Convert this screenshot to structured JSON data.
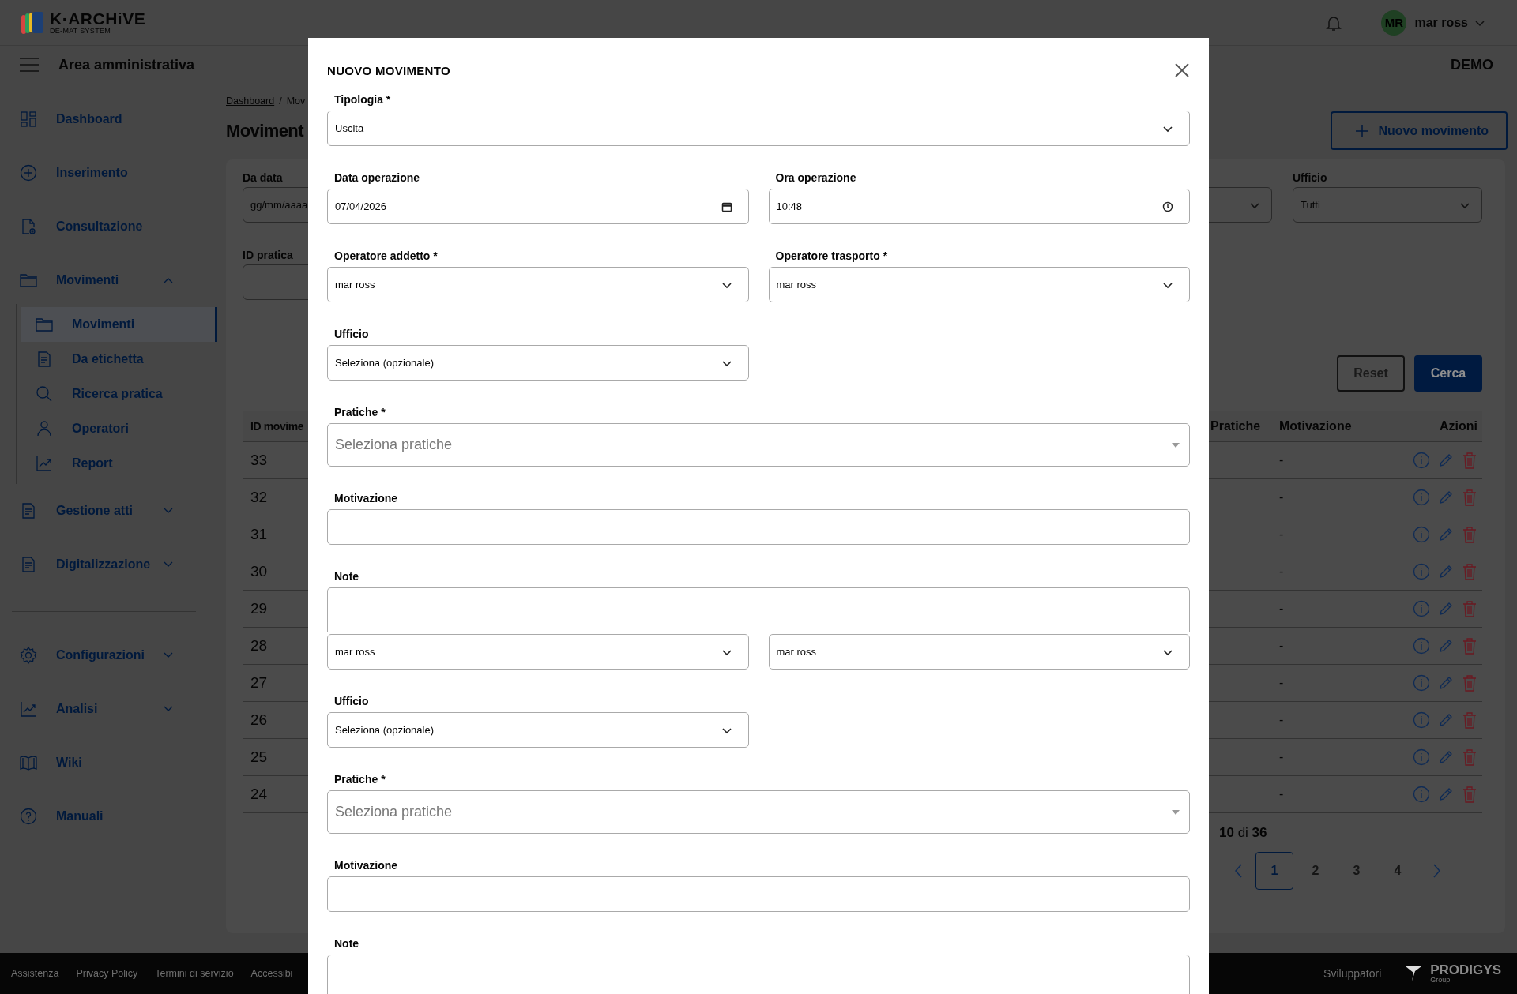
{
  "header": {
    "logo_title": "K·ARCHiVE",
    "logo_subtitle": "DE-MAT SYSTEM",
    "user": {
      "initials": "MR",
      "name": "mar ross"
    }
  },
  "subbar": {
    "title": "Area amministrativa",
    "environment": "DEMO"
  },
  "sidebar": {
    "groups": [
      [
        {
          "label": "Dashboard"
        },
        {
          "label": "Inserimento"
        },
        {
          "label": "Consultazione"
        },
        {
          "label": "Movimenti",
          "expanded": true,
          "children": [
            {
              "label": "Movimenti",
              "selected": true
            },
            {
              "label": "Da etichetta",
              "selected": false
            },
            {
              "label": "Ricerca pratica",
              "selected": false
            },
            {
              "label": "Operatori",
              "selected": false
            },
            {
              "label": "Report",
              "selected": false
            }
          ]
        },
        {
          "label": "Gestione atti",
          "expanded": false
        },
        {
          "label": "Digitalizzazione",
          "expanded": false
        }
      ],
      [
        {
          "label": "Configurazioni",
          "expanded": false
        },
        {
          "label": "Analisi",
          "expanded": false
        },
        {
          "label": "Wiki"
        },
        {
          "label": "Manuali"
        }
      ]
    ]
  },
  "main": {
    "breadcrumb": {
      "items": [
        "Dashboard",
        "Mov"
      ],
      "separator": "/"
    },
    "title": "Moviment",
    "new_button": "Nuovo movimento",
    "filters": {
      "date_label": "Da data",
      "date_placeholder": "gg/mm/aaaa",
      "id_label": "ID pratica",
      "office_label": "Ufficio",
      "office_value": "Tutti"
    },
    "buttons": {
      "reset": "Reset",
      "search": "Cerca"
    },
    "table": {
      "columns": [
        "ID movime",
        "Pratiche",
        "Motivazione",
        "Azioni"
      ],
      "rows": [
        {
          "id": "33",
          "motivazione": "-"
        },
        {
          "id": "32",
          "motivazione": "-"
        },
        {
          "id": "31",
          "motivazione": "-"
        },
        {
          "id": "30",
          "motivazione": "-"
        },
        {
          "id": "29",
          "motivazione": "-"
        },
        {
          "id": "28",
          "motivazione": "-"
        },
        {
          "id": "27",
          "motivazione": "-"
        },
        {
          "id": "26",
          "motivazione": "-"
        },
        {
          "id": "25",
          "motivazione": "-"
        },
        {
          "id": "24",
          "motivazione": "-"
        }
      ]
    },
    "pagination": {
      "summary": "**10** di **36**",
      "pages": [
        {
          "label": "1",
          "selected": true
        },
        {
          "label": "2",
          "selected": false
        },
        {
          "label": "3",
          "selected": false
        },
        {
          "label": "4",
          "selected": false
        }
      ]
    }
  },
  "footer": {
    "links": [
      "Assistenza",
      "Privacy Policy",
      "Termini di servizio",
      "Accessibi"
    ],
    "developers": "Sviluppatori",
    "brand": "PRODIGYS",
    "brand_sub": "Group"
  },
  "modal": {
    "title": "NUOVO MOVIMENTO",
    "rows": [
      [
        {
          "kind": "select",
          "label": "Tipologia *",
          "value": "Uscita",
          "wide": true
        }
      ],
      [
        {
          "kind": "date",
          "label": "Data operazione",
          "value": "07/04/2026"
        },
        {
          "kind": "time",
          "label": "Ora operazione",
          "value": "10:48"
        }
      ],
      [
        {
          "kind": "select",
          "label": "Operatore addetto *",
          "value": "mar ross"
        },
        {
          "kind": "select",
          "label": "Operatore trasporto *",
          "value": "mar ross"
        }
      ],
      [
        {
          "kind": "select",
          "label": "Ufficio",
          "value": "Seleziona (opzionale)"
        }
      ],
      [
        {
          "kind": "multiselect",
          "label": "Pratiche *",
          "placeholder": "Seleziona pratiche",
          "wide": true
        }
      ],
      [
        {
          "kind": "text",
          "label": "Motivazione",
          "wide": true
        }
      ],
      [
        {
          "kind": "textarea",
          "label": "Note",
          "wide": true,
          "clipped": true
        }
      ],
      [
        {
          "kind": "select",
          "value": "mar ross"
        },
        {
          "kind": "select",
          "value": "mar ross"
        }
      ],
      [
        {
          "kind": "select",
          "label": "Ufficio",
          "value": "Seleziona (opzionale)"
        }
      ],
      [
        {
          "kind": "multiselect",
          "label": "Pratiche *",
          "placeholder": "Seleziona pratiche",
          "wide": true
        }
      ],
      [
        {
          "kind": "text",
          "label": "Motivazione",
          "wide": true
        }
      ],
      [
        {
          "kind": "textarea",
          "label": "Note",
          "wide": true,
          "clipped": false
        }
      ]
    ]
  }
}
